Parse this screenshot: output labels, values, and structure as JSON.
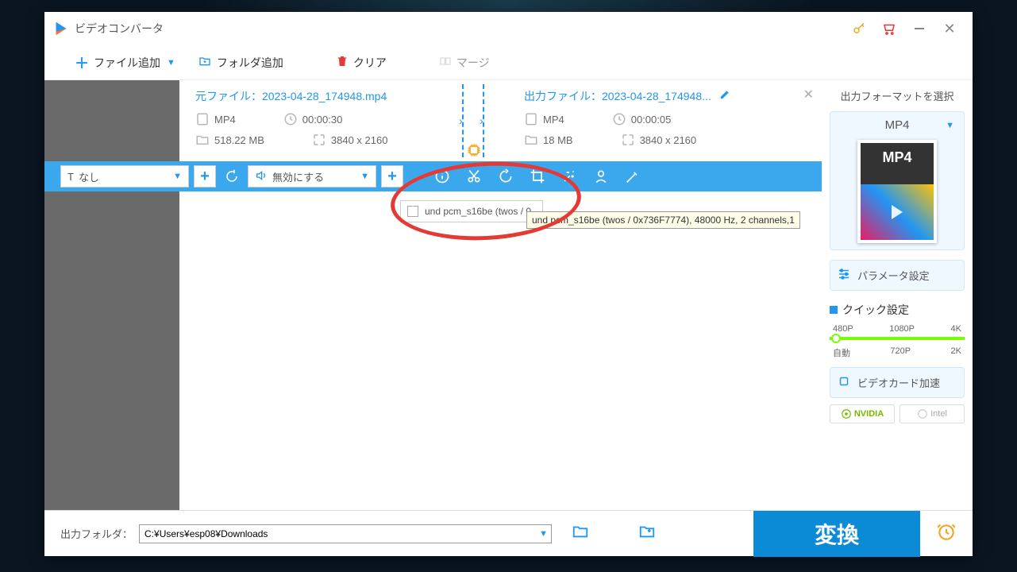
{
  "app": {
    "title": "ビデオコンバータ"
  },
  "toolbar": {
    "add_file": "ファイル追加",
    "add_folder": "フォルダ追加",
    "clear": "クリア",
    "merge": "マージ"
  },
  "item": {
    "source": {
      "label": "元ファイル：",
      "filename": "2023-04-28_174948.mp4",
      "format": "MP4",
      "duration": "00:00:30",
      "size": "518.22 MB",
      "resolution": "3840 x 2160"
    },
    "output": {
      "label": "出力ファイル：",
      "filename": "2023-04-28_174948...",
      "format": "MP4",
      "duration": "00:00:05",
      "size": "18 MB",
      "resolution": "3840 x 2160"
    },
    "gpu": "GPU"
  },
  "actionbar": {
    "subtitle_combo": "なし",
    "audio_combo": "無効にする",
    "dropdown_option": "und pcm_s16be (twos / 0",
    "tooltip": "und pcm_s16be (twos / 0x736F7774), 48000 Hz, 2 channels,1"
  },
  "sidebar": {
    "title": "出力フォーマットを選択",
    "format": "MP4",
    "thumb_label": "MP4",
    "param_settings": "パラメータ設定",
    "quick_settings": "クイック設定",
    "res_top": [
      "480P",
      "1080P",
      "4K"
    ],
    "res_bottom": [
      "自動",
      "720P",
      "2K"
    ],
    "gpu_accel": "ビデオカード加速",
    "nvidia": "NVIDIA",
    "intel": "Intel"
  },
  "bottom": {
    "label": "出力フォルダ：",
    "path": "C:¥Users¥esp08¥Downloads",
    "convert": "変換"
  }
}
